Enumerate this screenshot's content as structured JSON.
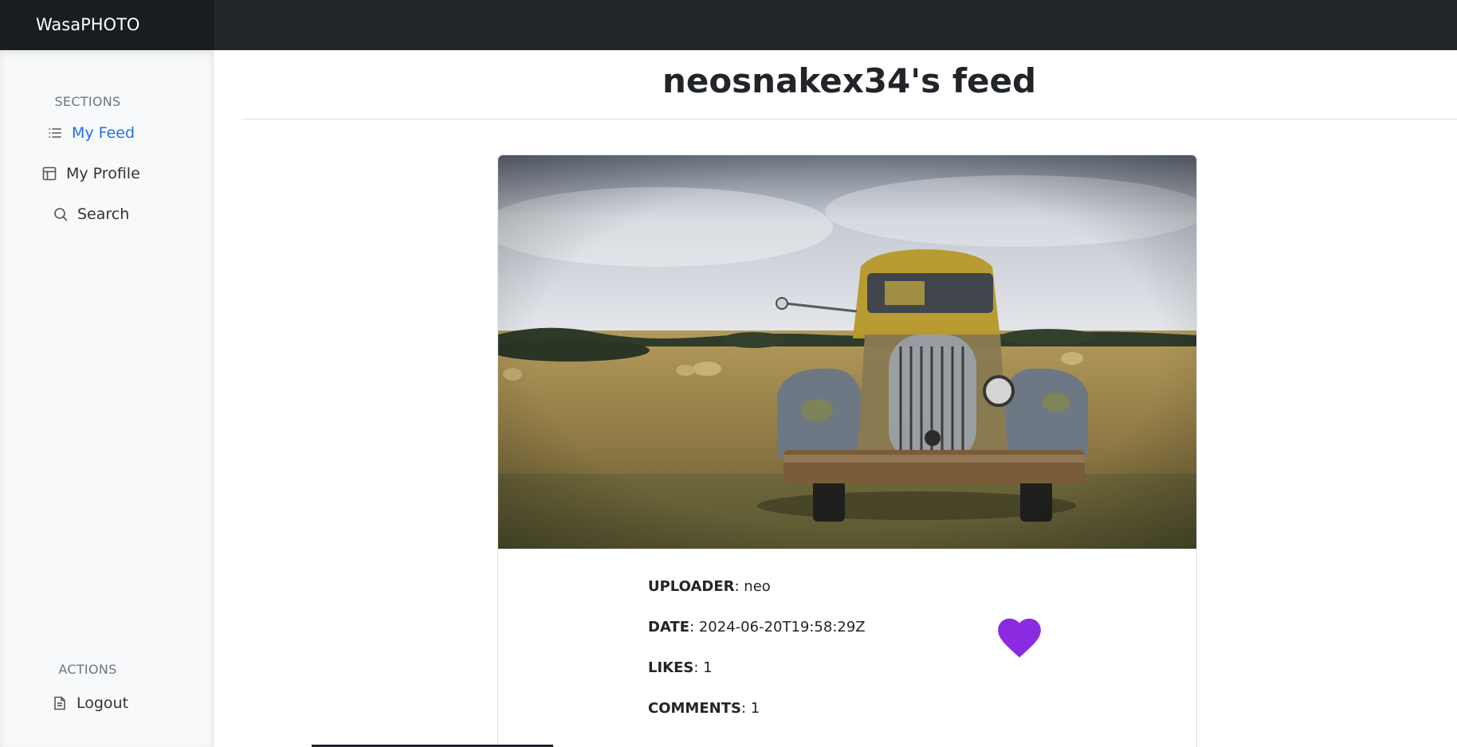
{
  "app": {
    "brand": "WasaPHOTO"
  },
  "sidebar": {
    "sections_heading": "SECTIONS",
    "items": [
      {
        "label": "My Feed",
        "icon": "list-icon",
        "active": true
      },
      {
        "label": "My Profile",
        "icon": "layout-icon",
        "active": false
      },
      {
        "label": "Search",
        "icon": "search-icon",
        "active": false
      }
    ],
    "actions_heading": "ACTIONS",
    "actions": [
      {
        "label": "Logout",
        "icon": "file-text-icon"
      }
    ]
  },
  "feed": {
    "username": "neosnakex34",
    "title_suffix": "'s feed"
  },
  "post": {
    "uploader_label": "UPLOADER",
    "uploader": "neo",
    "date_label": "DATE",
    "date": "2024-06-20T19:58:29Z",
    "likes_label": "LIKES",
    "likes": "1",
    "comments_label": "COMMENTS",
    "comments": "1",
    "like_icon": "heart-icon",
    "like_color": "#8a2be2"
  },
  "colors": {
    "accent": "#2470dc",
    "topbar": "#212529",
    "heart": "#8a2be2"
  }
}
